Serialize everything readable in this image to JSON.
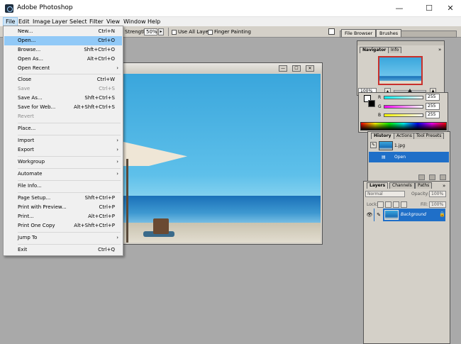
{
  "app": {
    "title": "Adobe Photoshop"
  },
  "window_controls": {
    "minimize": "—",
    "maximize": "☐",
    "close": "✕"
  },
  "menubar": [
    "File",
    "Edit",
    "Image",
    "Layer",
    "Select",
    "Filter",
    "View",
    "Window",
    "Help"
  ],
  "options": {
    "strength_label": "Strength:",
    "strength_value": "50%",
    "use_all_layers": "Use All Layers",
    "finger_painting": "Finger Painting",
    "tab_file_browser": "File Browser",
    "tab_brushes": "Brushes"
  },
  "file_menu": [
    {
      "label": "New...",
      "shortcut": "Ctrl+N"
    },
    {
      "label": "Open...",
      "shortcut": "Ctrl+O",
      "highlighted": true
    },
    {
      "label": "Browse...",
      "shortcut": "Shft+Ctrl+O"
    },
    {
      "label": "Open As...",
      "shortcut": "Alt+Ctrl+O"
    },
    {
      "label": "Open Recent",
      "submenu": true
    },
    {
      "label": "Close",
      "shortcut": "Ctrl+W"
    },
    {
      "label": "Save",
      "shortcut": "Ctrl+S",
      "disabled": true
    },
    {
      "label": "Save As...",
      "shortcut": "Shft+Ctrl+S"
    },
    {
      "label": "Save for Web...",
      "shortcut": "Alt+Shft+Ctrl+S"
    },
    {
      "label": "Revert",
      "disabled": true
    },
    {
      "label": "Place..."
    },
    {
      "label": "Import",
      "submenu": true
    },
    {
      "label": "Export",
      "submenu": true
    },
    {
      "label": "Workgroup",
      "submenu": true
    },
    {
      "label": "Automate",
      "submenu": true
    },
    {
      "label": "File Info..."
    },
    {
      "label": "Page Setup...",
      "shortcut": "Shft+Ctrl+P"
    },
    {
      "label": "Print with Preview...",
      "shortcut": "Ctrl+P"
    },
    {
      "label": "Print...",
      "shortcut": "Alt+Ctrl+P"
    },
    {
      "label": "Print One Copy",
      "shortcut": "Alt+Shft+Ctrl+P"
    },
    {
      "label": "Jump To",
      "submenu": true
    },
    {
      "label": "Exit",
      "shortcut": "Ctrl+Q"
    }
  ],
  "navigator": {
    "tabs": [
      "Navigator",
      "Info"
    ],
    "zoom": "100%"
  },
  "color": {
    "channels": [
      {
        "label": "R",
        "value": "255"
      },
      {
        "label": "G",
        "value": "255"
      },
      {
        "label": "B",
        "value": "255"
      }
    ]
  },
  "history": {
    "tabs": [
      "History",
      "Actions",
      "Tool Presets"
    ],
    "items": [
      {
        "label": "1.jpg"
      },
      {
        "label": "Open"
      }
    ]
  },
  "layers": {
    "tabs": [
      "Layers",
      "Channels",
      "Paths"
    ],
    "blend_mode": "Normal",
    "opacity_label": "Opacity:",
    "opacity_value": "100%",
    "lock_label": "Lock:",
    "fill_label": "Fill:",
    "fill_value": "100%",
    "layer_name": "Background"
  }
}
